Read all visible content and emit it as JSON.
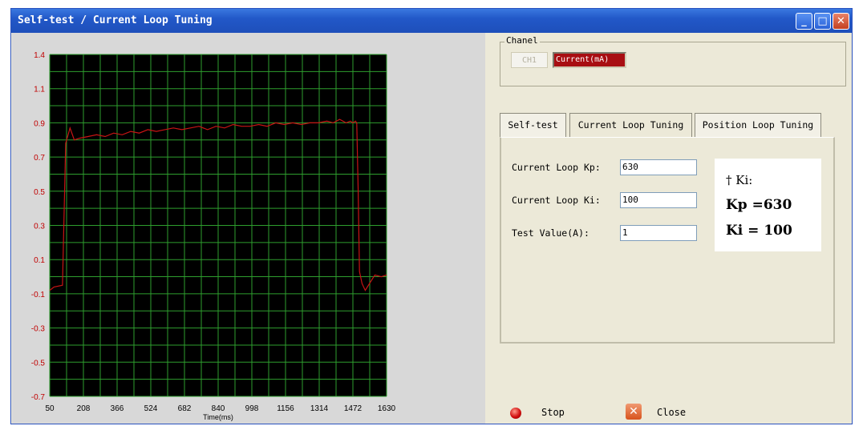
{
  "window": {
    "title": "Self-test / Current Loop Tuning",
    "controls": {
      "minimize": "_",
      "maximize": "□",
      "close": "✕"
    }
  },
  "chart_data": {
    "type": "line",
    "xlabel": "Time(ms)",
    "ylabel": "",
    "xlim": [
      50,
      1630
    ],
    "ylim": [
      -0.7,
      1.4
    ],
    "x_ticks": [
      50,
      208,
      366,
      524,
      682,
      840,
      998,
      1156,
      1314,
      1472,
      1630
    ],
    "y_ticks": [
      1.4,
      1.1,
      0.9,
      0.7,
      0.5,
      0.3,
      0.1,
      -0.1,
      -0.3,
      -0.5,
      -0.7
    ],
    "grid": true,
    "background": "#000000",
    "grid_color": "#2e9e2e",
    "line_color": "#c81414",
    "series": [
      {
        "x": [
          50,
          70,
          110,
          125,
          145,
          165,
          190,
          230,
          270,
          310,
          350,
          390,
          430,
          470,
          510,
          550,
          590,
          630,
          670,
          710,
          750,
          790,
          830,
          870,
          910,
          950,
          990,
          1030,
          1070,
          1110,
          1150,
          1190,
          1230,
          1270,
          1310,
          1350,
          1380,
          1410,
          1440,
          1460,
          1472,
          1484,
          1490,
          1497,
          1503,
          1515,
          1530,
          1550,
          1575,
          1605,
          1630
        ],
        "y": [
          -0.08,
          -0.06,
          -0.05,
          0.78,
          0.87,
          0.8,
          0.81,
          0.82,
          0.83,
          0.82,
          0.84,
          0.83,
          0.85,
          0.84,
          0.86,
          0.85,
          0.86,
          0.87,
          0.86,
          0.87,
          0.88,
          0.86,
          0.88,
          0.87,
          0.89,
          0.88,
          0.88,
          0.89,
          0.88,
          0.9,
          0.89,
          0.9,
          0.89,
          0.9,
          0.9,
          0.91,
          0.9,
          0.92,
          0.9,
          0.91,
          0.9,
          0.91,
          0.9,
          0.5,
          0.03,
          -0.04,
          -0.08,
          -0.04,
          0.01,
          0.0,
          0.01
        ]
      }
    ]
  },
  "channel": {
    "group_label": "Chanel",
    "ch_button": "CH1",
    "selected": "Current(mA)"
  },
  "tabs": [
    {
      "label": "Self-test"
    },
    {
      "label": "Current Loop Tuning"
    },
    {
      "label": "Position Loop Tuning"
    }
  ],
  "form": {
    "kp_label": "Current Loop Kp:",
    "kp_value": "630",
    "ki_label": "Current Loop Ki:",
    "ki_value": "100",
    "test_label": "Test Value(A):",
    "test_value": "1"
  },
  "note": {
    "line1": "† Ki:",
    "line2": "Kp =630",
    "line3": "Ki = 100"
  },
  "footer": {
    "stop_label": "Stop",
    "close_label": "Close",
    "close_icon": "✕"
  }
}
